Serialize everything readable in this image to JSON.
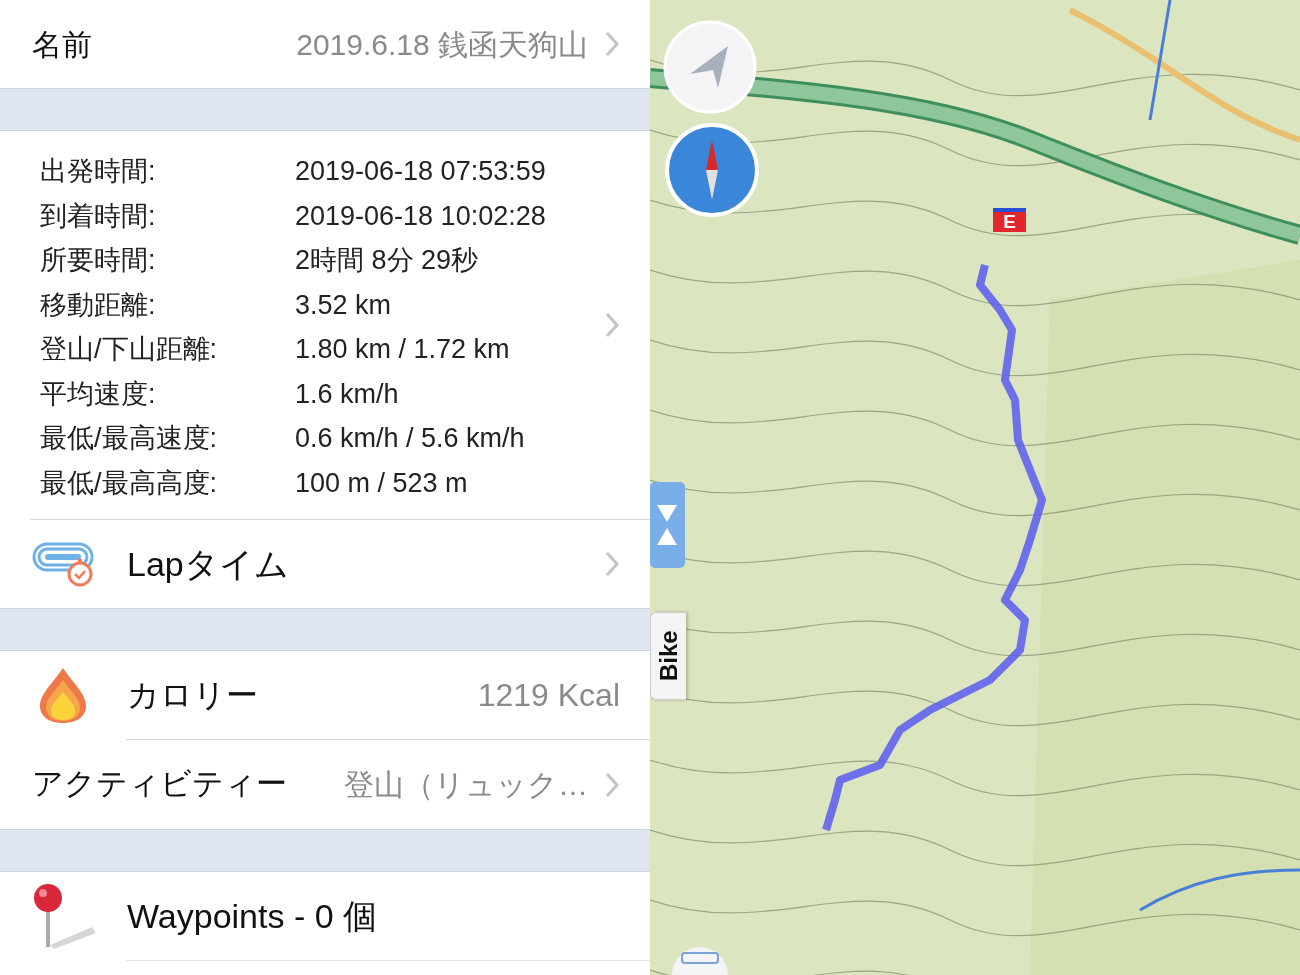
{
  "name_row": {
    "label": "名前",
    "value": "2019.6.18 銭函天狗山"
  },
  "stats": [
    {
      "label": "出発時間:",
      "value": "2019-06-18 07:53:59"
    },
    {
      "label": "到着時間:",
      "value": "2019-06-18 10:02:28"
    },
    {
      "label": "所要時間:",
      "value": "2時間 8分 29秒"
    },
    {
      "label": "移動距離:",
      "value": "3.52 km"
    },
    {
      "label": "登山/下山距離:",
      "value": "1.80 km / 1.72 km"
    },
    {
      "label": "平均速度:",
      "value": "1.6 km/h"
    },
    {
      "label": "最低/最高速度:",
      "value": "0.6 km/h / 5.6 km/h"
    },
    {
      "label": "最低/最高高度:",
      "value": "100 m / 523 m"
    }
  ],
  "lap_row": {
    "label": "Lapタイム"
  },
  "calorie_row": {
    "label": "カロリー",
    "value": "1219 Kcal"
  },
  "activity_row": {
    "label": "アクティビティー",
    "value": "登山（リュック…"
  },
  "waypoints_row": {
    "label": "Waypoints - 0 個"
  },
  "map": {
    "mode_tab": "Bike",
    "end_marker": "E"
  }
}
